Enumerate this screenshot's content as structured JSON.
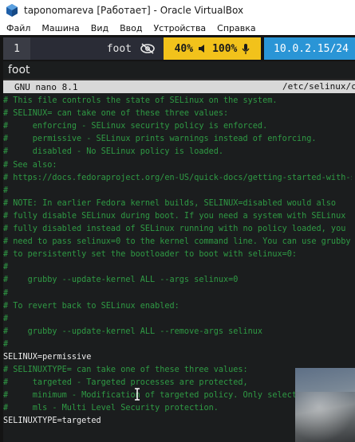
{
  "window": {
    "title": "taponomareva [Работает] - Oracle VirtualBox"
  },
  "menu": [
    "Файл",
    "Машина",
    "Вид",
    "Ввод",
    "Устройства",
    "Справка"
  ],
  "bar": {
    "workspace": "1",
    "window_title": "foot",
    "volume": "40%",
    "mic": "100%",
    "network": "10.0.2.15/24",
    "colors": {
      "volume_bg": "#f2c21b",
      "network_bg": "#2a95d6",
      "bar_bg": "#2a2c36"
    }
  },
  "terminal": {
    "title": "foot",
    "nano_version": "GNU nano 8.1",
    "filename": "/etc/selinux/config"
  },
  "file_lines": [
    {
      "text": "",
      "kind": "comment"
    },
    {
      "text": "# This file controls the state of SELinux on the system.",
      "kind": "comment"
    },
    {
      "text": "# SELINUX= can take one of these three values:",
      "kind": "comment"
    },
    {
      "text": "#     enforcing - SELinux security policy is enforced.",
      "kind": "comment"
    },
    {
      "text": "#     permissive - SELinux prints warnings instead of enforcing.",
      "kind": "comment"
    },
    {
      "text": "#     disabled - No SELinux policy is loaded.",
      "kind": "comment"
    },
    {
      "text": "# See also:",
      "kind": "comment"
    },
    {
      "text": "# https://docs.fedoraproject.org/en-US/quick-docs/getting-started-with-se",
      "kind": "comment"
    },
    {
      "text": "#",
      "kind": "comment"
    },
    {
      "text": "# NOTE: In earlier Fedora kernel builds, SELINUX=disabled would also",
      "kind": "comment"
    },
    {
      "text": "# fully disable SELinux during boot. If you need a system with SELinux",
      "kind": "comment"
    },
    {
      "text": "# fully disabled instead of SELinux running with no policy loaded, you",
      "kind": "comment"
    },
    {
      "text": "# need to pass selinux=0 to the kernel command line. You can use grubby",
      "kind": "comment"
    },
    {
      "text": "# to persistently set the bootloader to boot with selinux=0:",
      "kind": "comment"
    },
    {
      "text": "#",
      "kind": "comment"
    },
    {
      "text": "#    grubby --update-kernel ALL --args selinux=0",
      "kind": "comment"
    },
    {
      "text": "#",
      "kind": "comment"
    },
    {
      "text": "# To revert back to SELinux enabled:",
      "kind": "comment"
    },
    {
      "text": "#",
      "kind": "comment"
    },
    {
      "text": "#    grubby --update-kernel ALL --remove-args selinux",
      "kind": "comment"
    },
    {
      "text": "#",
      "kind": "comment"
    },
    {
      "text": "SELINUX=permissive",
      "kind": "cfg"
    },
    {
      "text": "# SELINUXTYPE= can take one of these three values:",
      "kind": "comment"
    },
    {
      "text": "#     targeted - Targeted processes are protected,",
      "kind": "comment"
    },
    {
      "text": "#     minimum - Modification of targeted policy. Only selected",
      "kind": "comment"
    },
    {
      "text": "#     mls - Multi Level Security protection.",
      "kind": "comment"
    },
    {
      "text": "SELINUXTYPE=targeted",
      "kind": "cfg"
    }
  ]
}
